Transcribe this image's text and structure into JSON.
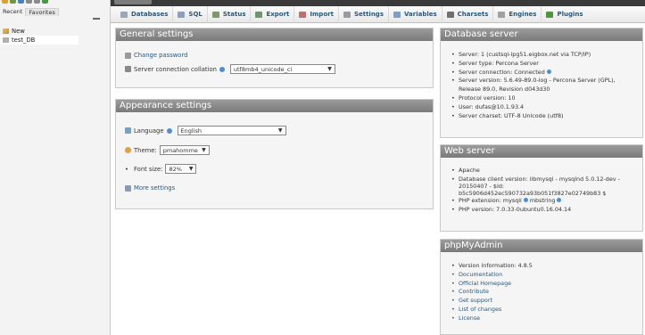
{
  "nav": {
    "tabs": [
      "Recent",
      "Favorites"
    ],
    "tree": [
      {
        "label": "New"
      },
      {
        "label": "test_DB"
      }
    ]
  },
  "menubar": {
    "items": [
      {
        "label": "Databases",
        "icon": "database-icon"
      },
      {
        "label": "SQL",
        "icon": "sql-icon"
      },
      {
        "label": "Status",
        "icon": "status-icon"
      },
      {
        "label": "Export",
        "icon": "export-icon"
      },
      {
        "label": "Import",
        "icon": "import-icon"
      },
      {
        "label": "Settings",
        "icon": "wrench-icon"
      },
      {
        "label": "Variables",
        "icon": "variables-icon"
      },
      {
        "label": "Charsets",
        "icon": "charsets-icon"
      },
      {
        "label": "Engines",
        "icon": "engines-icon"
      },
      {
        "label": "Plugins",
        "icon": "plugins-icon"
      }
    ]
  },
  "general": {
    "title": "General settings",
    "change_password": "Change password",
    "collation_label": "Server connection collation",
    "collation_value": "utf8mb4_unicode_ci"
  },
  "appearance": {
    "title": "Appearance settings",
    "language_label": "Language",
    "language_value": "English",
    "theme_label": "Theme:",
    "theme_value": "pmahomme",
    "fontsize_label": "Font size:",
    "fontsize_value": "82%",
    "more_settings": "More settings"
  },
  "db_server": {
    "title": "Database server",
    "items": [
      "Server: 1 (custsql-ipg51.eigbox.net via TCP/IP)",
      "Server type: Percona Server",
      "Server connection: Connected",
      "Server version: 5.6.49-89.0-log - Percona Server (GPL),",
      "Release 89.0, Revision d043d30",
      "Protocol version: 10",
      "User: dufas@10.1.93.4",
      "Server charset: UTF-8 Unicode (utf8)"
    ]
  },
  "web_server": {
    "title": "Web server",
    "items": [
      "Apache",
      "Database client version: libmysql - mysqlnd 5.0.12-dev -",
      "20150407 - $Id:",
      "b5c5906d452ec590732a93b051f3827e02749b83 $",
      "PHP extension: mysqli",
      "mbstring",
      "PHP version: 7.0.33-0ubuntu0.16.04.14"
    ]
  },
  "pma": {
    "title": "phpMyAdmin",
    "items": [
      "Version information: 4.8.5",
      "Documentation",
      "Official Homepage",
      "Contribute",
      "Get support",
      "List of changes",
      "License"
    ]
  }
}
